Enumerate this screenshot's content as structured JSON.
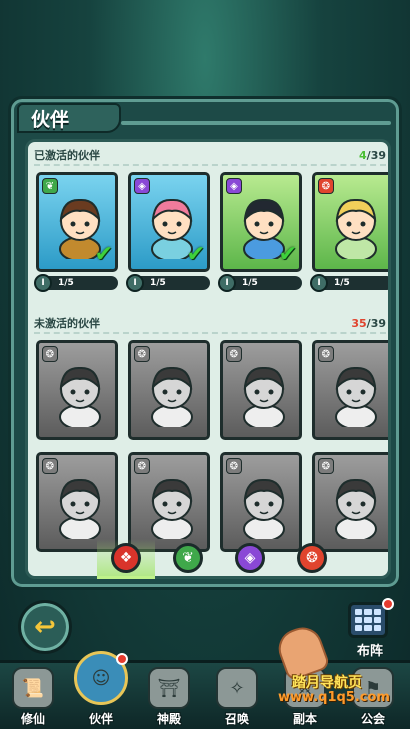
{
  "panel": {
    "title": "伙伴",
    "activated": {
      "label": "已激活的伙伴",
      "count_current": "4",
      "count_total": "/39",
      "cards": [
        {
          "element": "nature",
          "element_color": "#3fa84a",
          "frame": "blue",
          "level": "1/5",
          "hair": "#6a3b20",
          "outfit": "#c28a2e"
        },
        {
          "element": "arcane",
          "element_color": "#8a48d6",
          "frame": "blue",
          "level": "1/5",
          "hair": "#f07b9c",
          "outfit": "#7ad0e0"
        },
        {
          "element": "arcane",
          "element_color": "#8a48d6",
          "frame": "green",
          "level": "1/5",
          "hair": "#222831",
          "outfit": "#4b9be0"
        },
        {
          "element": "fire",
          "element_color": "#e0442e",
          "frame": "green",
          "level": "1/5",
          "hair": "#f1cf5a",
          "outfit": "#bfe7a6"
        }
      ]
    },
    "inactive": {
      "label": "未激活的伙伴",
      "count_current": "35",
      "count_total": "/39",
      "cards": [
        {
          "element": "fire"
        },
        {
          "element": "fire"
        },
        {
          "element": "fire"
        },
        {
          "element": "fire"
        },
        {
          "element": "fire"
        },
        {
          "element": "fire"
        },
        {
          "element": "fire"
        },
        {
          "element": "fire"
        }
      ]
    },
    "filters": [
      {
        "name": "all",
        "color": "#d9342b",
        "glyph": "❖",
        "selected": true
      },
      {
        "name": "nature",
        "color": "#3fa84a",
        "glyph": "❦",
        "selected": false
      },
      {
        "name": "arcane",
        "color": "#8a48d6",
        "glyph": "◈",
        "selected": false
      },
      {
        "name": "fire",
        "color": "#e0442e",
        "glyph": "❂",
        "selected": false
      }
    ]
  },
  "formation_label": "布阵",
  "nav": [
    {
      "label": "修仙",
      "icon": "scroll-icon",
      "active": false
    },
    {
      "label": "伙伴",
      "icon": "partner-icon",
      "active": true
    },
    {
      "label": "神殿",
      "icon": "temple-icon",
      "active": false
    },
    {
      "label": "召唤",
      "icon": "summon-icon",
      "active": false
    },
    {
      "label": "副本",
      "icon": "dungeon-icon",
      "active": false
    },
    {
      "label": "公会",
      "icon": "guild-icon",
      "active": false
    }
  ],
  "watermark": {
    "text": "踏月导航页",
    "url": "www.q1q5.com"
  }
}
